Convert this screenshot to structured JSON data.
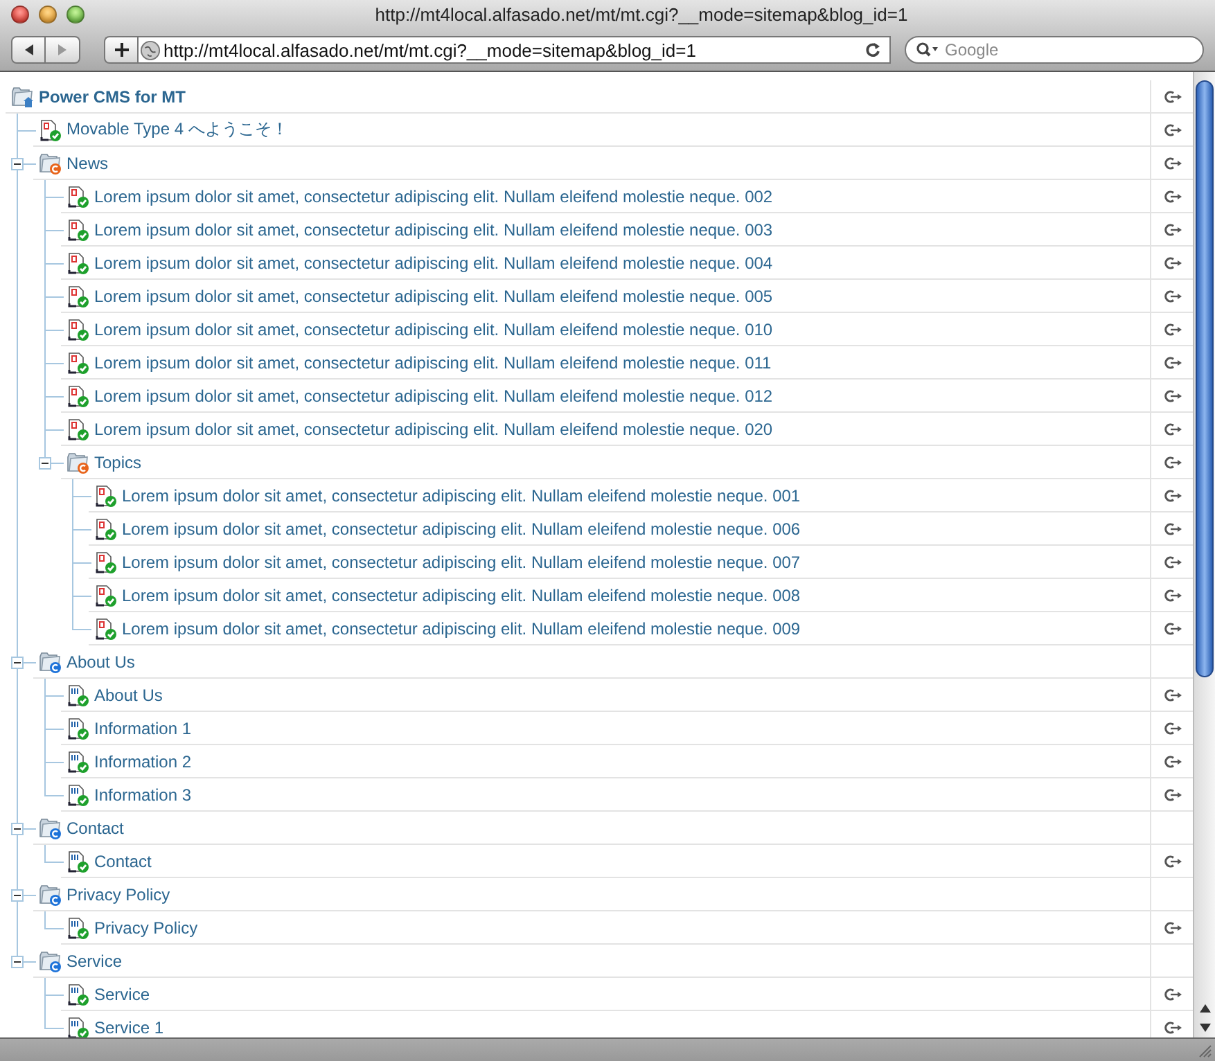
{
  "window": {
    "title": "http://mt4local.alfasado.net/mt/mt.cgi?__mode=sitemap&blog_id=1"
  },
  "toolbar": {
    "address": "http://mt4local.alfasado.net/mt/mt.cgi?__mode=sitemap&blog_id=1",
    "search": {
      "placeholder": "Google"
    }
  },
  "sitemap": {
    "label": "Power CMS for MT",
    "kind": "blog",
    "link": true,
    "children": [
      {
        "label": "Movable Type 4 へようこそ！",
        "kind": "entry",
        "link": true
      },
      {
        "label": "News",
        "kind": "category",
        "link": true,
        "expanded": true,
        "children": [
          {
            "label": "Lorem ipsum dolor sit amet, consectetur adipiscing elit. Nullam eleifend molestie neque. 002",
            "kind": "entry",
            "link": true
          },
          {
            "label": "Lorem ipsum dolor sit amet, consectetur adipiscing elit. Nullam eleifend molestie neque. 003",
            "kind": "entry",
            "link": true
          },
          {
            "label": "Lorem ipsum dolor sit amet, consectetur adipiscing elit. Nullam eleifend molestie neque. 004",
            "kind": "entry",
            "link": true
          },
          {
            "label": "Lorem ipsum dolor sit amet, consectetur adipiscing elit. Nullam eleifend molestie neque. 005",
            "kind": "entry",
            "link": true
          },
          {
            "label": "Lorem ipsum dolor sit amet, consectetur adipiscing elit. Nullam eleifend molestie neque. 010",
            "kind": "entry",
            "link": true
          },
          {
            "label": "Lorem ipsum dolor sit amet, consectetur adipiscing elit. Nullam eleifend molestie neque. 011",
            "kind": "entry",
            "link": true
          },
          {
            "label": "Lorem ipsum dolor sit amet, consectetur adipiscing elit. Nullam eleifend molestie neque. 012",
            "kind": "entry",
            "link": true
          },
          {
            "label": "Lorem ipsum dolor sit amet, consectetur adipiscing elit. Nullam eleifend molestie neque. 020",
            "kind": "entry",
            "link": true
          },
          {
            "label": "Topics",
            "kind": "category",
            "link": true,
            "expanded": true,
            "children": [
              {
                "label": "Lorem ipsum dolor sit amet, consectetur adipiscing elit. Nullam eleifend molestie neque. 001",
                "kind": "entry",
                "link": true
              },
              {
                "label": "Lorem ipsum dolor sit amet, consectetur adipiscing elit. Nullam eleifend molestie neque. 006",
                "kind": "entry",
                "link": true
              },
              {
                "label": "Lorem ipsum dolor sit amet, consectetur adipiscing elit. Nullam eleifend molestie neque. 007",
                "kind": "entry",
                "link": true
              },
              {
                "label": "Lorem ipsum dolor sit amet, consectetur adipiscing elit. Nullam eleifend molestie neque. 008",
                "kind": "entry",
                "link": true
              },
              {
                "label": "Lorem ipsum dolor sit amet, consectetur adipiscing elit. Nullam eleifend molestie neque. 009",
                "kind": "entry",
                "link": true
              }
            ]
          }
        ]
      },
      {
        "label": "About Us",
        "kind": "folder",
        "link": false,
        "expanded": true,
        "children": [
          {
            "label": "About Us",
            "kind": "page",
            "link": true
          },
          {
            "label": "Information 1",
            "kind": "page",
            "link": true
          },
          {
            "label": "Information 2",
            "kind": "page",
            "link": true
          },
          {
            "label": "Information 3",
            "kind": "page",
            "link": true
          }
        ]
      },
      {
        "label": "Contact",
        "kind": "folder",
        "link": false,
        "expanded": true,
        "children": [
          {
            "label": "Contact",
            "kind": "page",
            "link": true
          }
        ]
      },
      {
        "label": "Privacy Policy",
        "kind": "folder",
        "link": false,
        "expanded": true,
        "children": [
          {
            "label": "Privacy Policy",
            "kind": "page",
            "link": true
          }
        ]
      },
      {
        "label": "Service",
        "kind": "folder",
        "link": false,
        "expanded": true,
        "children": [
          {
            "label": "Service",
            "kind": "page",
            "link": true
          },
          {
            "label": "Service 1",
            "kind": "page",
            "link": true
          }
        ]
      }
    ]
  }
}
